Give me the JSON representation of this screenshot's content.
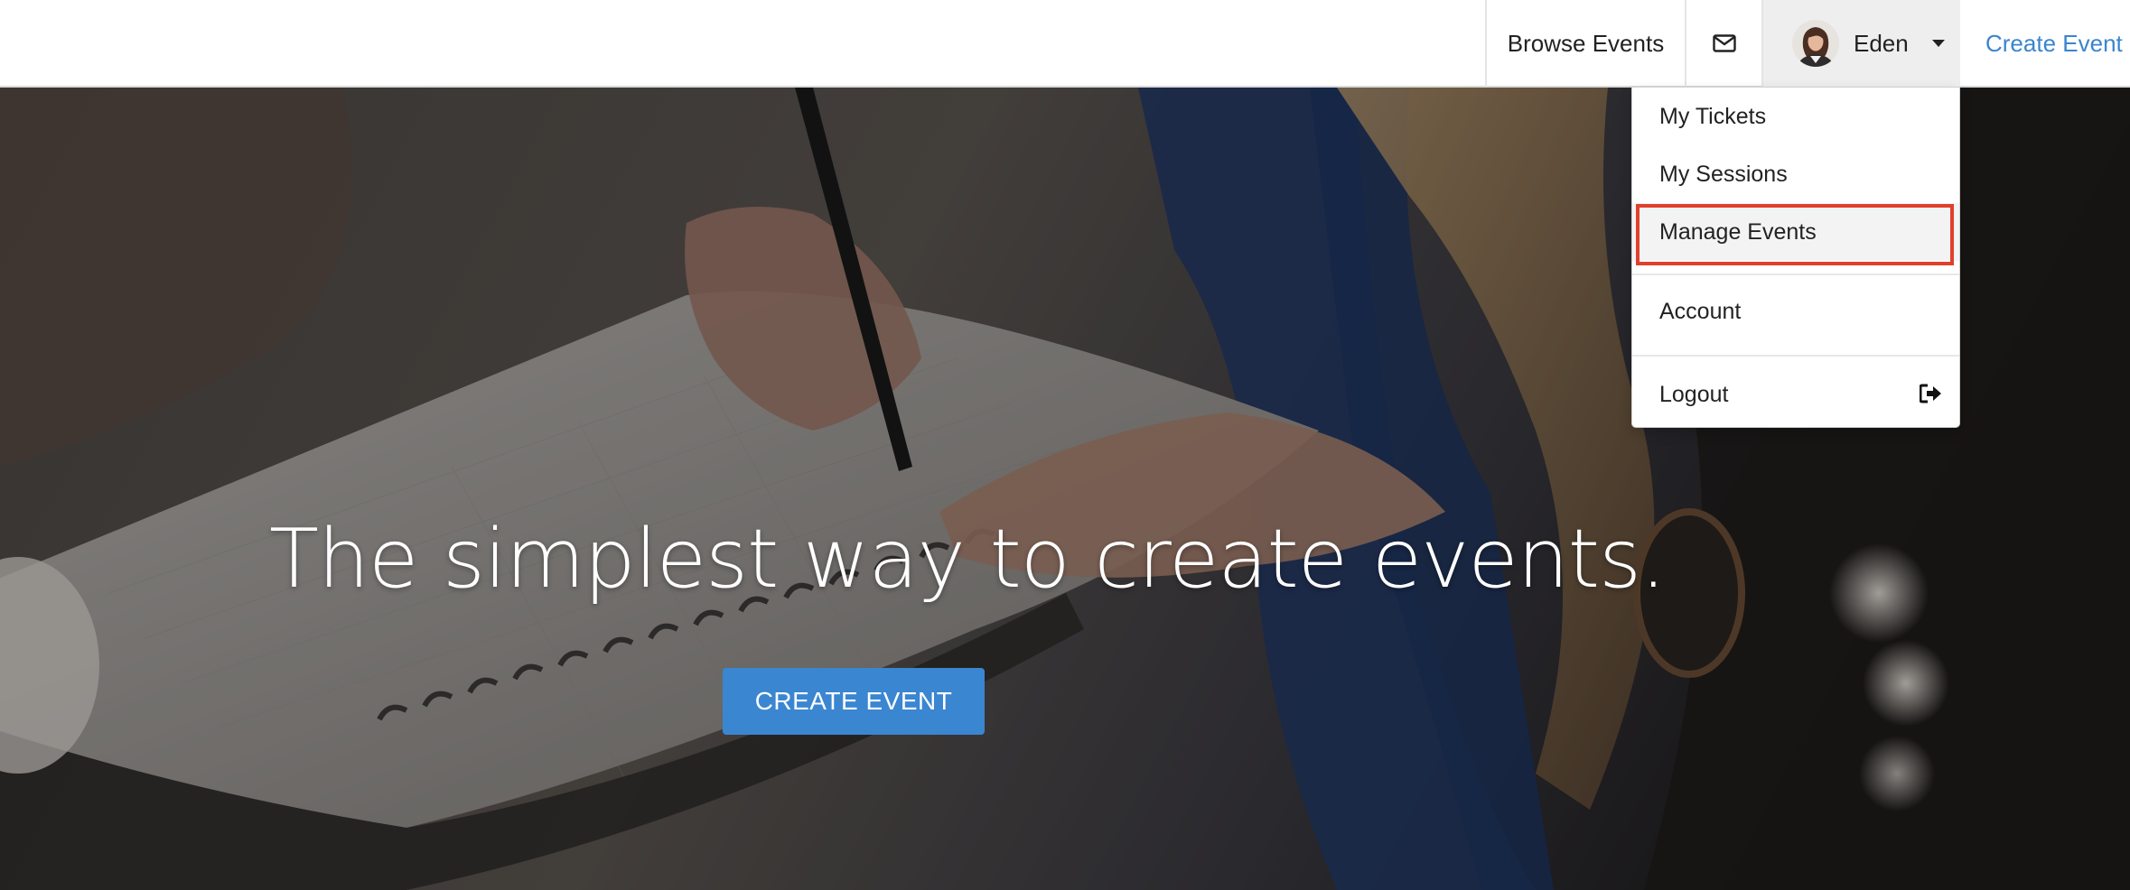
{
  "nav": {
    "browse_events": "Browse Events",
    "mail_icon": "envelope-icon",
    "user_name": "Eden",
    "caret_icon": "caret-down-icon",
    "create_event": "Create Event"
  },
  "hero": {
    "title": "The simplest way to create events.",
    "cta": "CREATE EVENT"
  },
  "user_menu": {
    "items": [
      {
        "label": "My Tickets"
      },
      {
        "label": "My Sessions"
      },
      {
        "label": "Manage Events"
      },
      {
        "label": "Account"
      },
      {
        "label": "Logout",
        "icon": "sign-out-icon"
      }
    ],
    "highlighted": "Manage Events"
  },
  "colors": {
    "link": "#3a85cf",
    "button": "#3b86d1",
    "highlight_border": "#e0402c"
  }
}
